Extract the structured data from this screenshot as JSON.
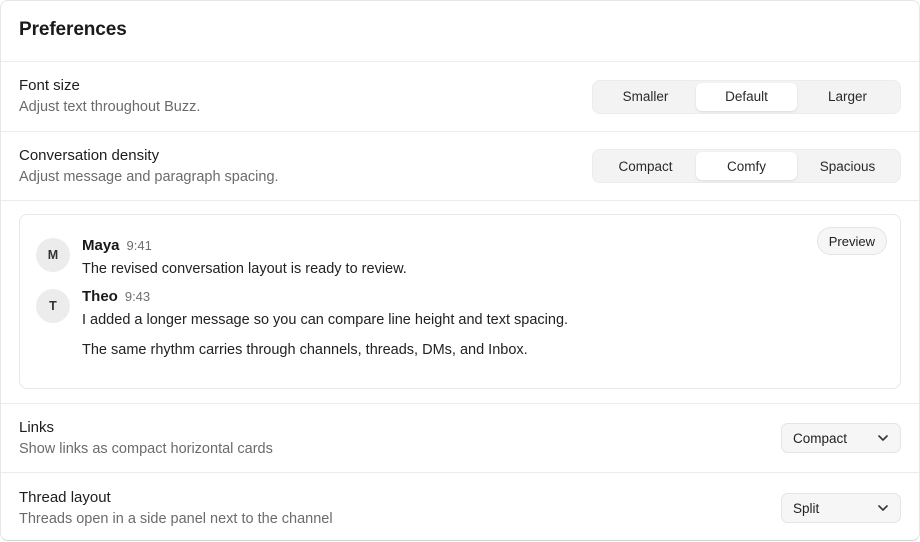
{
  "header": {
    "title": "Preferences"
  },
  "font_size": {
    "title": "Font size",
    "description": "Adjust text throughout Buzz.",
    "options": [
      "Smaller",
      "Default",
      "Larger"
    ],
    "selected": "Default"
  },
  "density": {
    "title": "Conversation density",
    "description": "Adjust message and paragraph spacing.",
    "options": [
      "Compact",
      "Comfy",
      "Spacious"
    ],
    "selected": "Comfy"
  },
  "preview": {
    "button_label": "Preview",
    "messages": [
      {
        "initial": "M",
        "name": "Maya",
        "time": "9:41",
        "lines": [
          "The revised conversation layout is ready to review."
        ]
      },
      {
        "initial": "T",
        "name": "Theo",
        "time": "9:43",
        "lines": [
          "I added a longer message so you can compare line height and text spacing.",
          "The same rhythm carries through channels, threads, DMs, and Inbox."
        ]
      }
    ]
  },
  "links": {
    "title": "Links",
    "description": "Show links as compact horizontal cards",
    "value": "Compact",
    "icon": "chevron-down-icon"
  },
  "thread_layout": {
    "title": "Thread layout",
    "description": "Threads open in a side panel next to the channel",
    "value": "Split",
    "icon": "chevron-down-icon"
  }
}
